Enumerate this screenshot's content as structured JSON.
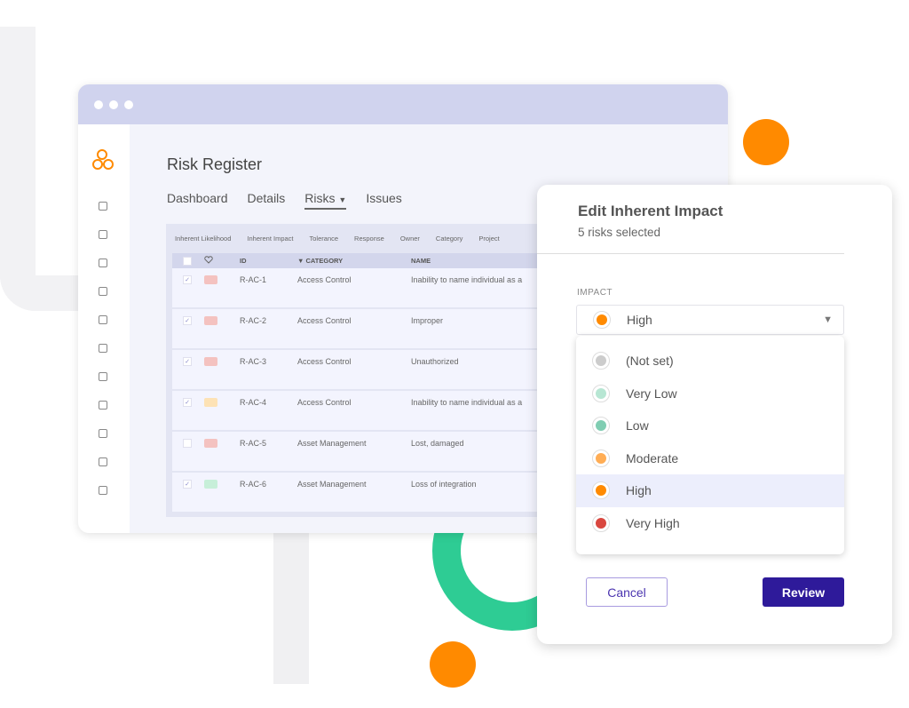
{
  "colors": {
    "accent": "#ff8a00",
    "primary": "#2e1a9a",
    "window_bar": "#d0d3ee",
    "ring": "#2ecc94"
  },
  "app": {
    "title": "Risk Register",
    "tabs": [
      {
        "label": "Dashboard"
      },
      {
        "label": "Details"
      },
      {
        "label": "Risks",
        "active": true,
        "caret": "▼"
      },
      {
        "label": "Issues"
      }
    ]
  },
  "sidebar": {
    "icons": [
      "dashboard-icon",
      "cube-icon",
      "shield-icon",
      "git-branch-icon",
      "bookmark-icon",
      "cloud-upload-icon",
      "report-icon",
      "clipboard-icon",
      "tags-icon",
      "flag-icon",
      "truck-icon"
    ]
  },
  "filters": [
    "Inherent Likelihood",
    "Inherent Impact",
    "Tolerance",
    "Response",
    "Owner",
    "Category",
    "Project"
  ],
  "table": {
    "headers": {
      "id": "ID",
      "category": "▼ CATEGORY",
      "name": "NAME"
    },
    "rows": [
      {
        "checked": true,
        "badge": "#f4c2c0",
        "id": "R-AC-1",
        "category": "Access Control",
        "name": "Inability to name individual as a"
      },
      {
        "checked": true,
        "badge": "#f4c2c0",
        "id": "R-AC-2",
        "category": "Access Control",
        "name": "Improper"
      },
      {
        "checked": true,
        "badge": "#f4c2c0",
        "id": "R-AC-3",
        "category": "Access Control",
        "name": "Unauthorized"
      },
      {
        "checked": true,
        "badge": "#fde2b5",
        "id": "R-AC-4",
        "category": "Access Control",
        "name": "Inability to name individual as a"
      },
      {
        "checked": false,
        "badge": "#f4c2c0",
        "id": "R-AC-5",
        "category": "Asset Management",
        "name": "Lost, damaged"
      },
      {
        "checked": true,
        "badge": "#c7efd9",
        "id": "R-AC-6",
        "category": "Asset Management",
        "name": "Loss of integration"
      }
    ]
  },
  "modal": {
    "title": "Edit Inherent Impact",
    "subtitle": "5 risks selected",
    "field_label": "IMPACT",
    "selected": {
      "label": "High",
      "color": "#ff8a00"
    },
    "options": [
      {
        "label": "(Not set)",
        "color": "#cccccc"
      },
      {
        "label": "Very Low",
        "color": "#b7e6d3"
      },
      {
        "label": "Low",
        "color": "#80cdb2"
      },
      {
        "label": "Moderate",
        "color": "#ffad55"
      },
      {
        "label": "High",
        "color": "#ff8a00",
        "highlighted": true
      },
      {
        "label": "Very High",
        "color": "#d9473f"
      }
    ],
    "cancel_label": "Cancel",
    "review_label": "Review"
  }
}
